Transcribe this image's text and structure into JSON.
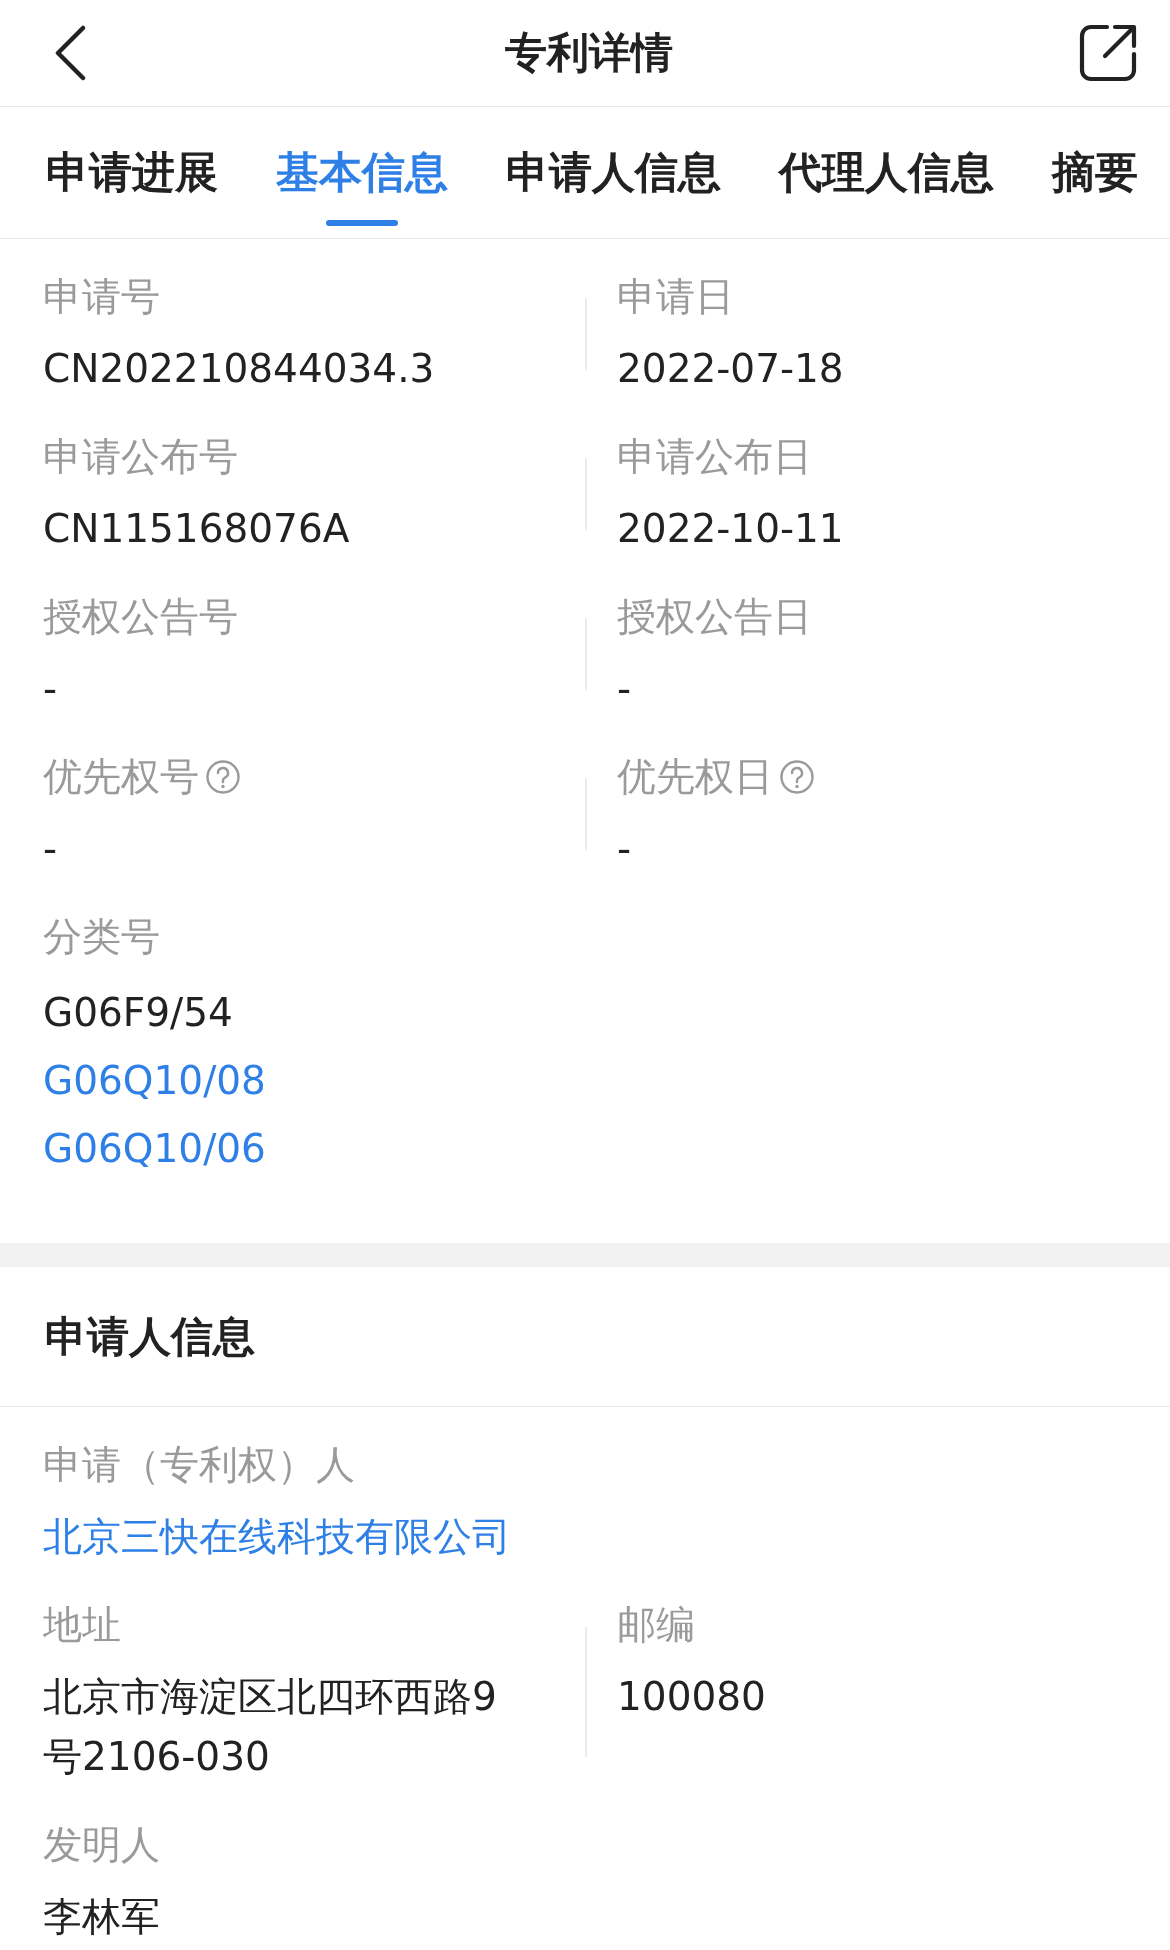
{
  "header": {
    "title": "专利详情"
  },
  "tabs": [
    {
      "label": "申请进展",
      "selected": false
    },
    {
      "label": "基本信息",
      "selected": true
    },
    {
      "label": "申请人信息",
      "selected": false
    },
    {
      "label": "代理人信息",
      "selected": false
    },
    {
      "label": "摘要",
      "selected": false
    }
  ],
  "basic_info": {
    "pairs": [
      {
        "left": {
          "label": "申请号",
          "value": "CN202210844034.3",
          "help": false
        },
        "right": {
          "label": "申请日",
          "value": "2022-07-18",
          "help": false
        }
      },
      {
        "left": {
          "label": "申请公布号",
          "value": "CN115168076A",
          "help": false
        },
        "right": {
          "label": "申请公布日",
          "value": "2022-10-11",
          "help": false
        }
      },
      {
        "left": {
          "label": "授权公告号",
          "value": "-",
          "help": false
        },
        "right": {
          "label": "授权公告日",
          "value": "-",
          "help": false
        }
      },
      {
        "left": {
          "label": "优先权号",
          "value": "-",
          "help": true
        },
        "right": {
          "label": "优先权日",
          "value": "-",
          "help": true
        }
      }
    ],
    "classification": {
      "label": "分类号",
      "codes": [
        {
          "text": "G06F9/54",
          "link": false
        },
        {
          "text": "G06Q10/08",
          "link": true
        },
        {
          "text": "G06Q10/06",
          "link": true
        }
      ]
    }
  },
  "applicant_section": {
    "title": "申请人信息",
    "applicant": {
      "label": "申请（专利权）人",
      "value": "北京三快在线科技有限公司"
    },
    "address": {
      "label": "地址",
      "value": "北京市海淀区北四环西路9号2106-030"
    },
    "postcode": {
      "label": "邮编",
      "value": "100080"
    },
    "inventor": {
      "label": "发明人",
      "value": "李林军"
    }
  }
}
